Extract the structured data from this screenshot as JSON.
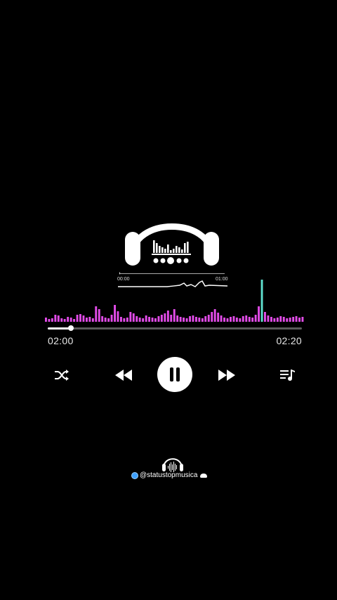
{
  "player": {
    "elapsed": "02:00",
    "total": "02:20",
    "progress_fraction": 0.09
  },
  "logo": {
    "mini_start": "00:00",
    "mini_end": "01:00"
  },
  "visualizer": {
    "levels": [
      6,
      4,
      5,
      10,
      9,
      5,
      4,
      7,
      6,
      4,
      10,
      11,
      9,
      6,
      7,
      5,
      22,
      18,
      8,
      6,
      5,
      10,
      24,
      15,
      7,
      5,
      6,
      14,
      12,
      8,
      6,
      5,
      9,
      7,
      6,
      5,
      8,
      10,
      12,
      16,
      10,
      18,
      9,
      7,
      6,
      5,
      8,
      9,
      7,
      6,
      5,
      8,
      10,
      14,
      18,
      13,
      9,
      6,
      5,
      7,
      8,
      6,
      5,
      8,
      9,
      7,
      6,
      10,
      22,
      60,
      14,
      9,
      7,
      5,
      6,
      8,
      7,
      5,
      6,
      7,
      8,
      6,
      7
    ],
    "accent_color": "#e24ce8",
    "peak_color": "#5fe0cf"
  },
  "controls": {
    "shuffle": "shuffle-icon",
    "previous": "rewind-icon",
    "pause": "pause-icon",
    "next": "fast-forward-icon",
    "queue": "queue-icon"
  },
  "watermark": {
    "handle": "@statustopmusica"
  }
}
